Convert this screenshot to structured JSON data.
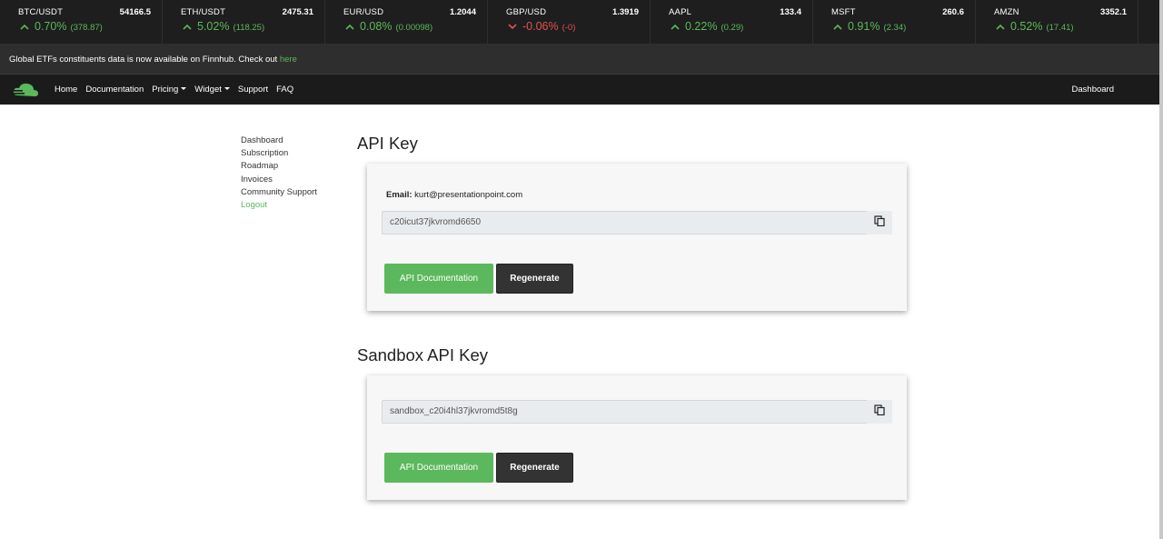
{
  "tickers": [
    {
      "symbol": "BTC/USDT",
      "price": "54166.5",
      "change": "0.70%",
      "abs": "(378.87)",
      "direction": "up"
    },
    {
      "symbol": "ETH/USDT",
      "price": "2475.31",
      "change": "5.02%",
      "abs": "(118.25)",
      "direction": "up"
    },
    {
      "symbol": "EUR/USD",
      "price": "1.2044",
      "change": "0.08%",
      "abs": "(0.00098)",
      "direction": "up"
    },
    {
      "symbol": "GBP/USD",
      "price": "1.3919",
      "change": "-0.06%",
      "abs": "(-0)",
      "direction": "down"
    },
    {
      "symbol": "AAPL",
      "price": "133.4",
      "change": "0.22%",
      "abs": "(0.29)",
      "direction": "up"
    },
    {
      "symbol": "MSFT",
      "price": "260.6",
      "change": "0.91%",
      "abs": "(2.34)",
      "direction": "up"
    },
    {
      "symbol": "AMZN",
      "price": "3352.1",
      "change": "0.52%",
      "abs": "(17.41)",
      "direction": "up"
    }
  ],
  "announcement": {
    "text": "Global ETFs constituents data is now available on Finnhub. Check out",
    "link": "here"
  },
  "nav": {
    "logo_icon": "cloud-logo-icon",
    "links": [
      "Home",
      "Documentation",
      "Pricing",
      "Widget",
      "Support",
      "FAQ"
    ],
    "right": "Dashboard"
  },
  "sidebar": {
    "items": [
      "Dashboard",
      "Subscription",
      "Roadmap",
      "Invoices",
      "Community Support",
      "Logout"
    ]
  },
  "api_key": {
    "title": "API Key",
    "email_label": "Email:",
    "email": "kurt@presentationpoint.com",
    "key": "c20icut37jkvromd6650",
    "doc_button": "API Documentation",
    "regen_button": "Regenerate",
    "copy_icon": "copy-icon"
  },
  "sandbox_key": {
    "title": "Sandbox API Key",
    "key": "sandbox_c20i4hl37jkvromd5t8g",
    "doc_button": "API Documentation",
    "regen_button": "Regenerate",
    "copy_icon": "copy-icon"
  },
  "colors": {
    "accent": "#5cb85c",
    "down": "#e0524e",
    "dark": "#1e1e1e"
  }
}
